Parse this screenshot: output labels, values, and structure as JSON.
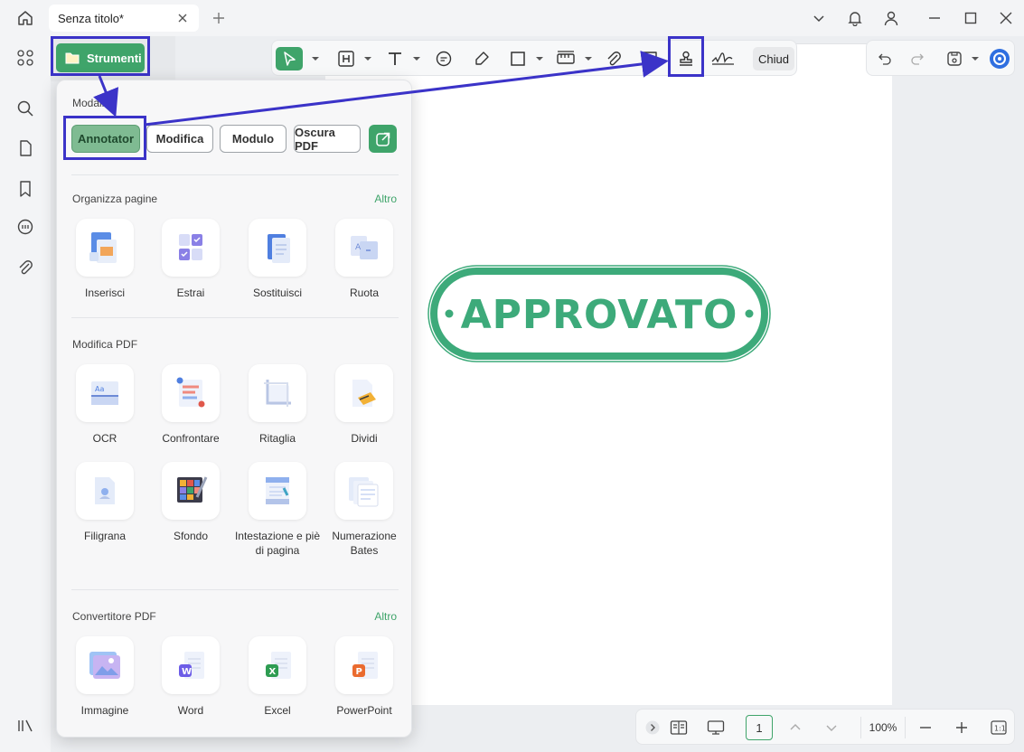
{
  "titlebar": {
    "tab_title": "Senza titolo*"
  },
  "strumenti": {
    "label": "Strumenti"
  },
  "toolbar": {
    "close_label": "Chiud"
  },
  "stamp": {
    "text": "APPROVATO"
  },
  "panel": {
    "mode_title": "Modalità",
    "modes": [
      "Annotator",
      "Modifica",
      "Modulo",
      "Oscura PDF"
    ],
    "sections": [
      {
        "title": "Organizza pagine",
        "altro": "Altro",
        "tools": [
          "Inserisci",
          "Estrai",
          "Sostituisci",
          "Ruota"
        ]
      },
      {
        "title": "Modifica PDF",
        "altro": "",
        "tools": [
          "OCR",
          "Confrontare",
          "Ritaglia",
          "Dividi",
          "Filigrana",
          "Sfondo",
          "Intestazione e piè di pagina",
          "Numerazione Bates"
        ]
      },
      {
        "title": "Convertitore PDF",
        "altro": "Altro",
        "tools": [
          "Immagine",
          "Word",
          "Excel",
          "PowerPoint"
        ]
      }
    ]
  },
  "bottombar": {
    "page": "1",
    "zoom": "100%"
  },
  "colors": {
    "accent": "#3fa46a",
    "highlight": "#3b33c8",
    "stamp": "#3daa7a"
  }
}
